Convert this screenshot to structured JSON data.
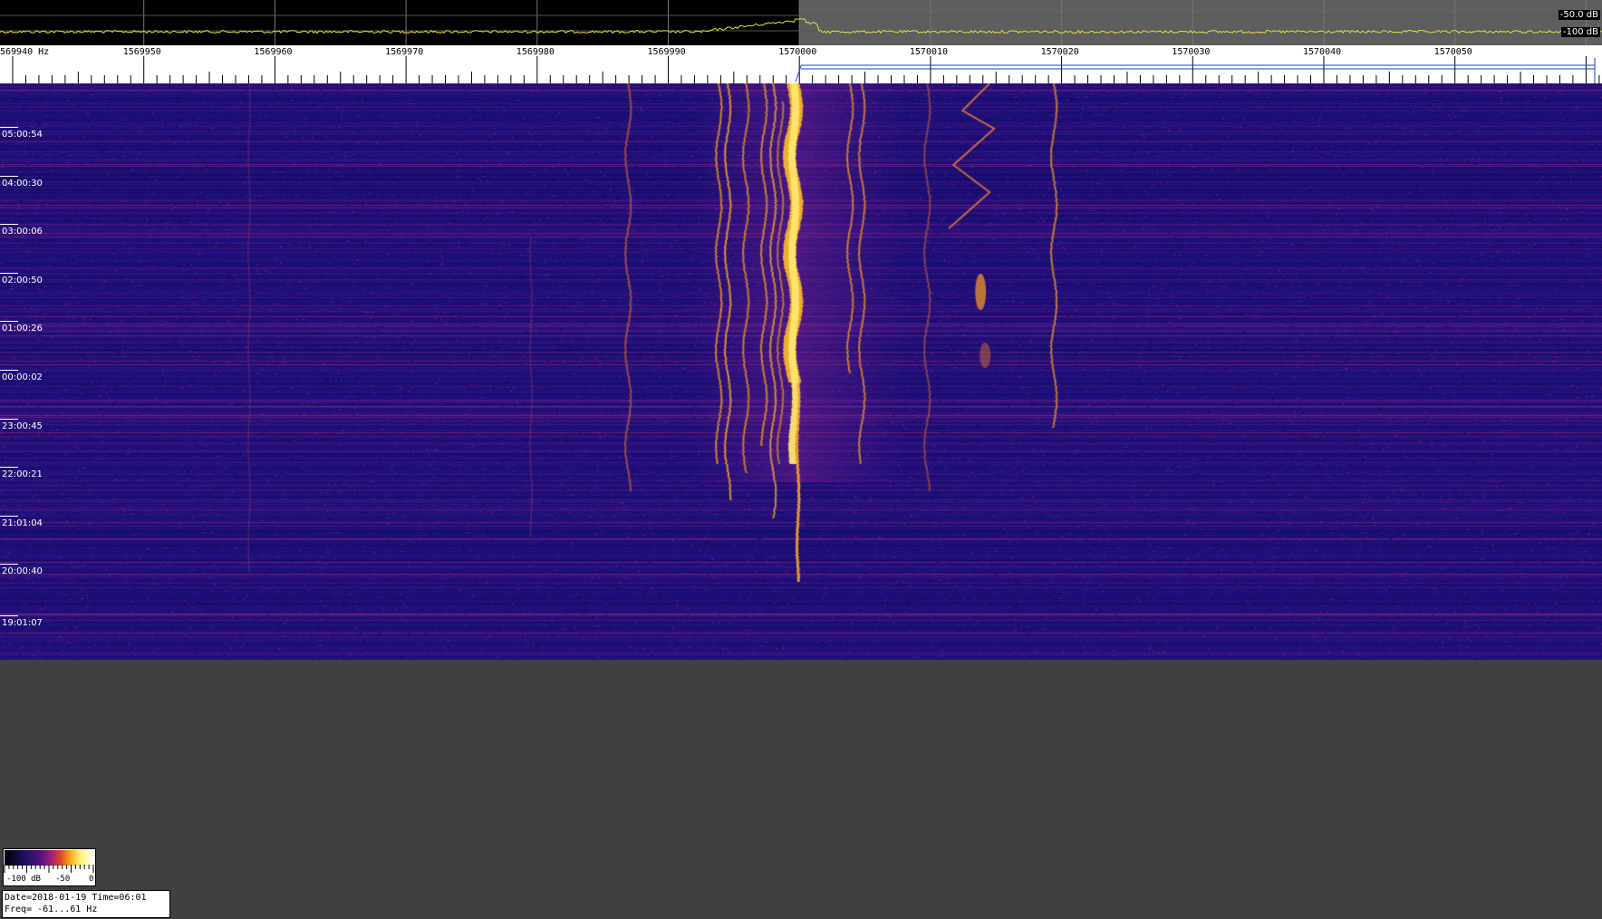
{
  "spectrum": {
    "db_top": "-50.0 dB",
    "db_bottom": "-100 dB"
  },
  "ruler": {
    "labels": [
      {
        "hz": 1569940,
        "text": "569940 Hz"
      },
      {
        "hz": 1569950,
        "text": "1569950"
      },
      {
        "hz": 1569960,
        "text": "1569960"
      },
      {
        "hz": 1569970,
        "text": "1569970"
      },
      {
        "hz": 1569980,
        "text": "1569980"
      },
      {
        "hz": 1569990,
        "text": "1569990"
      },
      {
        "hz": 1570000,
        "text": "1570000"
      },
      {
        "hz": 1570010,
        "text": "1570010"
      },
      {
        "hz": 1570020,
        "text": "1570020"
      },
      {
        "hz": 1570030,
        "text": "1570030"
      },
      {
        "hz": 1570040,
        "text": "1570040"
      },
      {
        "hz": 1570050,
        "text": "1570050"
      }
    ]
  },
  "waterfall": {
    "times": [
      "05:00:54",
      "04:00:30",
      "03:00:06",
      "02:00:50",
      "01:00:26",
      "00:00:02",
      "23:00:45",
      "22:00:21",
      "21:01:04",
      "20:00:40",
      "19:01:07"
    ]
  },
  "colorbar": {
    "label_min": "-100 dB",
    "label_mid": "-50",
    "label_max": "0"
  },
  "info": {
    "line1": "Date=2018-01-19 Time=06:01",
    "line2": "Freq= -61...61 Hz"
  },
  "colors": {
    "waterfall_base": "#1c0f78",
    "signal_hot": "#ffd24a",
    "spectrum_trace": "#e8e23a",
    "background": "#404040"
  }
}
